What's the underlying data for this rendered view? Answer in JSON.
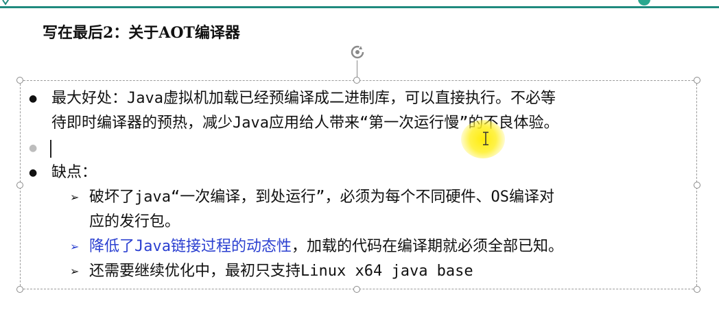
{
  "slide": {
    "title": "写在最后2：关于AOT编译器",
    "bullets": [
      {
        "lines": [
          "最大好处：Java虚拟机加载已经预编译成二进制库，可以直接执行。不必等",
          "待即时编译器的预热，减少Java应用给人带来“第一次运行慢”的不良体验。"
        ]
      },
      {
        "lines": [
          ""
        ]
      },
      {
        "label": "缺点：",
        "subitems": [
          {
            "lines": [
              "破坏了java“一次编译，到处运行”，必须为每个不同硬件、OS编译对",
              "应的发行包。"
            ]
          },
          {
            "highlight": "降低了Java链接过程的动态性",
            "rest": "，加载的代码在编译期就必须全部已知。"
          },
          {
            "lines": [
              "还需要继续优化中，最初只支持Linux x64 java base"
            ]
          }
        ]
      }
    ]
  },
  "colors": {
    "accent_bar": "#1f8a7e",
    "blue_text": "#2a3fd0",
    "pointer_highlight": "#ffeb00"
  },
  "icons": {
    "rotate": "rotate-handle-icon",
    "cursor": "text-cursor-icon"
  }
}
